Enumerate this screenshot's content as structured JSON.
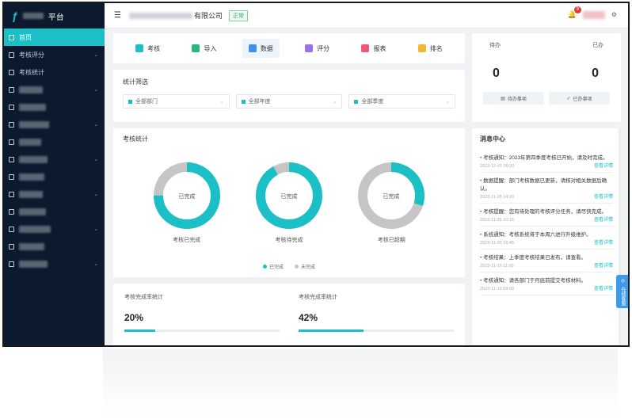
{
  "sidebar": {
    "logo_text": "平台",
    "items": [
      {
        "label": "首页",
        "active": true
      },
      {
        "label": "考核评分",
        "active": false
      },
      {
        "label": "考核统计",
        "active": false
      },
      {
        "label": "",
        "active": false
      },
      {
        "label": "",
        "active": false
      },
      {
        "label": "",
        "active": false
      },
      {
        "label": "",
        "active": false
      },
      {
        "label": "",
        "active": false
      },
      {
        "label": "",
        "active": false
      },
      {
        "label": "",
        "active": false
      },
      {
        "label": "",
        "active": false
      },
      {
        "label": "",
        "active": false
      },
      {
        "label": "",
        "active": false
      },
      {
        "label": "",
        "active": false
      }
    ]
  },
  "topbar": {
    "hamburger": "☰",
    "org_suffix": "有限公司",
    "tag": "正常",
    "bell": "🔔",
    "badge": "9",
    "settings": "⚙"
  },
  "nav": {
    "buttons": [
      {
        "label": "考核",
        "color": "#1bc0c7",
        "selected": false
      },
      {
        "label": "导入",
        "color": "#28b67a",
        "selected": false
      },
      {
        "label": "数据",
        "color": "#3d8ff0",
        "selected": true
      },
      {
        "label": "评分",
        "color": "#9b6fe8",
        "selected": false
      },
      {
        "label": "报表",
        "color": "#ef5b6e",
        "selected": false
      },
      {
        "label": "排名",
        "color": "#f2b632",
        "selected": false
      }
    ]
  },
  "filter": {
    "title": "统计筛选",
    "selects": [
      "全部部门",
      "全部年度",
      "全部季度"
    ]
  },
  "donut_section": {
    "title": "考核统计",
    "donuts": [
      {
        "center": "已完成",
        "label": "考核已完成",
        "fraction": 0.75
      },
      {
        "center": "已完成",
        "label": "考核待完成",
        "fraction": 0.92
      },
      {
        "center": "已完成",
        "label": "考核已超期",
        "fraction": 0.3
      }
    ],
    "legend": [
      {
        "label": "已完成",
        "color": "#1bc0c7"
      },
      {
        "label": "未完成",
        "color": "#c5c5c5"
      }
    ]
  },
  "progress": [
    {
      "label": "考核完成率统计",
      "value": "20%",
      "fraction": 0.2
    },
    {
      "label": "考核完成率统计",
      "value": "42%",
      "fraction": 0.42
    }
  ],
  "stats": {
    "heads": [
      "待办",
      "已办"
    ],
    "nums": [
      "0",
      "0"
    ],
    "buttons": [
      "待办事项",
      "已办事项"
    ]
  },
  "messages": {
    "title": "消息中心",
    "items": [
      {
        "text": "考核通知：2023年第四季度考核已开始，请及时完成。",
        "date": "2023-12-01 09:30",
        "link": "查看详情"
      },
      {
        "text": "数据提醒：部门考核数据已更新，请核对相关数据后确认。",
        "date": "2023-11-28 14:20",
        "link": "查看详情"
      },
      {
        "text": "考核提醒：您有待处理的考核评分任务，请尽快完成。",
        "date": "2023-11-25 10:15",
        "link": "查看详情"
      },
      {
        "text": "系统通知：考核系统将于本周六进行升级维护。",
        "date": "2023-11-20 16:45",
        "link": "查看详情"
      },
      {
        "text": "考核结果：上季度考核结果已发布，请查看。",
        "date": "2023-11-15 11:00",
        "link": "查看详情"
      },
      {
        "text": "考核通知：请各部门于月底前提交考核材料。",
        "date": "2023-11-10 09:00",
        "link": "查看详情"
      }
    ]
  },
  "float_button": "在线客服"
}
